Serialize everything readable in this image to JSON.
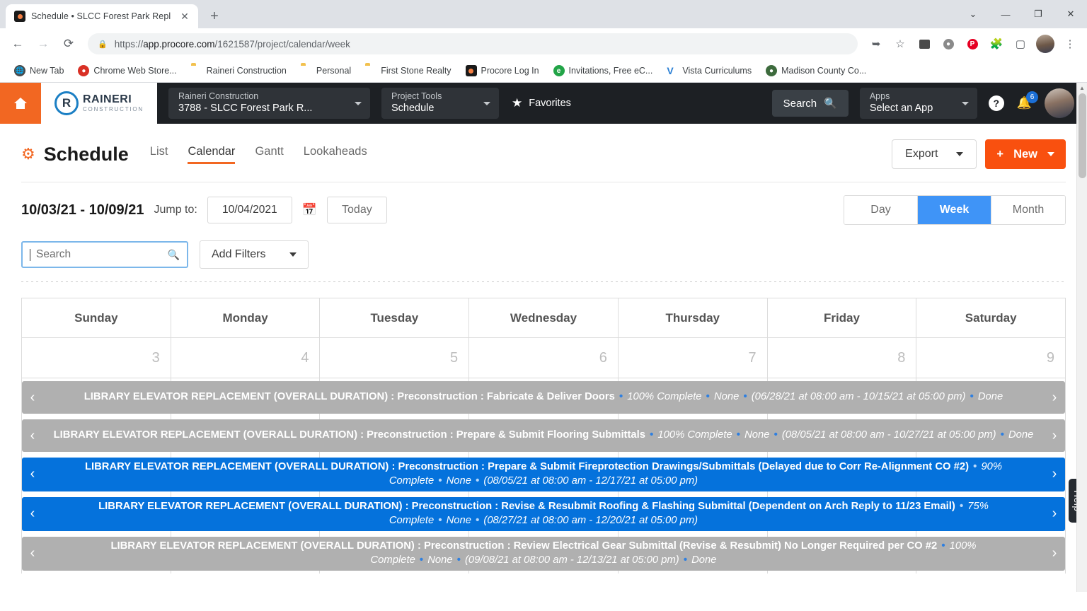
{
  "browser": {
    "tab": {
      "title": "Schedule • SLCC Forest Park Repl",
      "favicon": "procore-favicon",
      "close": "✕"
    },
    "newtab_label": "+",
    "window": {
      "minimize": "—",
      "maximize": "❐",
      "close": "✕",
      "chevron": "⌄"
    },
    "nav": {
      "back": "←",
      "forward": "→",
      "reload": "⟳"
    },
    "omnibox": {
      "lock": "🔒",
      "url_prefix": "https://",
      "url_host": "app.procore.com",
      "url_path": "/1621587/project/calendar/week"
    },
    "toolbar_icons": [
      "share-icon",
      "bookmark-star-icon",
      "extension-cast-icon",
      "extension-adblock-icon",
      "extension-pinterest-icon",
      "extensions-puzzle-icon",
      "side-panel-icon",
      "profile-avatar",
      "chrome-menu-icon"
    ],
    "bookmarks": [
      {
        "label": "New Tab",
        "icon": "globe-icon"
      },
      {
        "label": "Chrome Web Store...",
        "icon": "chrome-store-icon"
      },
      {
        "label": "Raineri Construction",
        "icon": "folder-icon"
      },
      {
        "label": "Personal",
        "icon": "folder-icon"
      },
      {
        "label": "First Stone Realty",
        "icon": "folder-icon"
      },
      {
        "label": "Procore Log In",
        "icon": "procore-icon"
      },
      {
        "label": "Invitations, Free eC...",
        "icon": "evite-icon"
      },
      {
        "label": "Vista Curriculums",
        "icon": "vista-icon"
      },
      {
        "label": "Madison County Co...",
        "icon": "madison-icon"
      }
    ]
  },
  "topnav": {
    "home_icon": "home-icon",
    "logo": {
      "mark": "R",
      "name": "RAINERI",
      "sub": "CONSTRUCTION"
    },
    "company_select": {
      "label": "Raineri Construction",
      "value": "3788 - SLCC Forest Park R..."
    },
    "tools_select": {
      "label": "Project Tools",
      "value": "Schedule"
    },
    "favorites_label": "Favorites",
    "search_label": "Search",
    "apps_select": {
      "label": "Apps",
      "value": "Select an App"
    },
    "help_icon": "question-mark-icon",
    "notifications": {
      "icon": "bell-icon",
      "count": "6"
    },
    "avatar": "user-avatar"
  },
  "page": {
    "gear_icon": "gear-icon",
    "title": "Schedule",
    "tabs": [
      {
        "label": "List",
        "active": false
      },
      {
        "label": "Calendar",
        "active": true
      },
      {
        "label": "Gantt",
        "active": false
      },
      {
        "label": "Lookaheads",
        "active": false
      }
    ],
    "export_label": "Export",
    "new_label": "New",
    "new_plus": "+"
  },
  "datebar": {
    "range": "10/03/21 - 10/09/21",
    "jump_label": "Jump to:",
    "date_value": "10/04/2021",
    "calendar_icon": "calendar-icon",
    "today_label": "Today",
    "views": [
      {
        "label": "Day",
        "active": false
      },
      {
        "label": "Week",
        "active": true
      },
      {
        "label": "Month",
        "active": false
      }
    ]
  },
  "filters": {
    "search_placeholder": "Search",
    "search_value": "",
    "search_icon": "search-icon",
    "add_filters_label": "Add Filters"
  },
  "calendar": {
    "days": [
      {
        "name": "Sunday",
        "num": "3"
      },
      {
        "name": "Monday",
        "num": "4"
      },
      {
        "name": "Tuesday",
        "num": "5"
      },
      {
        "name": "Wednesday",
        "num": "6"
      },
      {
        "name": "Thursday",
        "num": "7"
      },
      {
        "name": "Friday",
        "num": "8"
      },
      {
        "name": "Saturday",
        "num": "9"
      }
    ],
    "prev_arrow": "‹",
    "next_arrow": "›",
    "events": [
      {
        "color": "gray",
        "title": "LIBRARY ELEVATOR REPLACEMENT (OVERALL DURATION) : Preconstruction : Fabricate & Deliver Doors",
        "percent": "100% Complete",
        "resource": "None",
        "dates": "(06/28/21 at 08:00 am - 10/15/21 at 05:00 pm)",
        "status": "Done"
      },
      {
        "color": "gray",
        "title": "LIBRARY ELEVATOR REPLACEMENT (OVERALL DURATION) : Preconstruction : Prepare & Submit Flooring Submittals",
        "percent": "100% Complete",
        "resource": "None",
        "dates": "(08/05/21 at 08:00 am - 10/27/21 at 05:00 pm)",
        "status": "Done"
      },
      {
        "color": "blue",
        "title": "LIBRARY ELEVATOR REPLACEMENT (OVERALL DURATION) : Preconstruction : Prepare & Submit Fireprotection Drawings/Submittals (Delayed due to Corr Re-Alignment CO #2)",
        "percent": "90% Complete",
        "resource": "None",
        "dates": "(08/05/21 at 08:00 am - 12/17/21 at 05:00 pm)",
        "status": ""
      },
      {
        "color": "blue",
        "title": "LIBRARY ELEVATOR REPLACEMENT (OVERALL DURATION) : Preconstruction : Revise & Resubmit Roofing & Flashing Submittal (Dependent on Arch Reply to 11/23 Email)",
        "percent": "75% Complete",
        "resource": "None",
        "dates": "(08/27/21 at 08:00 am - 12/20/21 at 05:00 pm)",
        "status": ""
      },
      {
        "color": "gray",
        "title": "LIBRARY ELEVATOR REPLACEMENT (OVERALL DURATION) : Preconstruction : Review Electrical Gear Submittal (Revise & Resubmit) No Longer Required per CO #2",
        "percent": "100% Complete",
        "resource": "None",
        "dates": "(09/08/21 at 08:00 am - 12/13/21 at 05:00 pm)",
        "status": "Done"
      }
    ]
  },
  "help_tab": {
    "label": "Help"
  },
  "colors": {
    "brand_orange": "#f26722",
    "new_button": "#f9500f",
    "active_blue": "#3f94f7",
    "event_blue": "#0572dc",
    "event_gray": "#b0b0b0",
    "topnav_dark": "#1d2024"
  }
}
